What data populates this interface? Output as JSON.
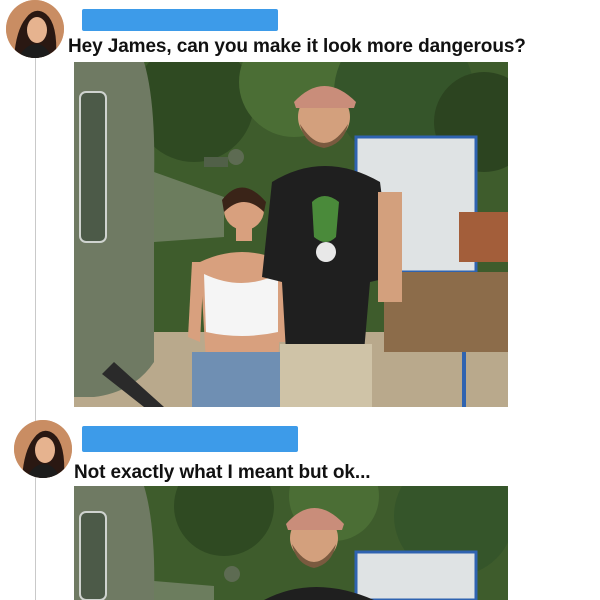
{
  "posts": [
    {
      "author_redacted": true,
      "text": "Hey James, can you make it look more dangerous?",
      "avatar_icon": "profile-photo",
      "image_icon": "photo-attachment"
    },
    {
      "author_redacted": true,
      "text": "Not exactly what I meant but ok...",
      "avatar_icon": "profile-photo",
      "image_icon": "photo-attachment"
    }
  ],
  "colors": {
    "redaction": "#3d9be9",
    "thread_line": "#c9c9c9",
    "text": "#111111"
  }
}
